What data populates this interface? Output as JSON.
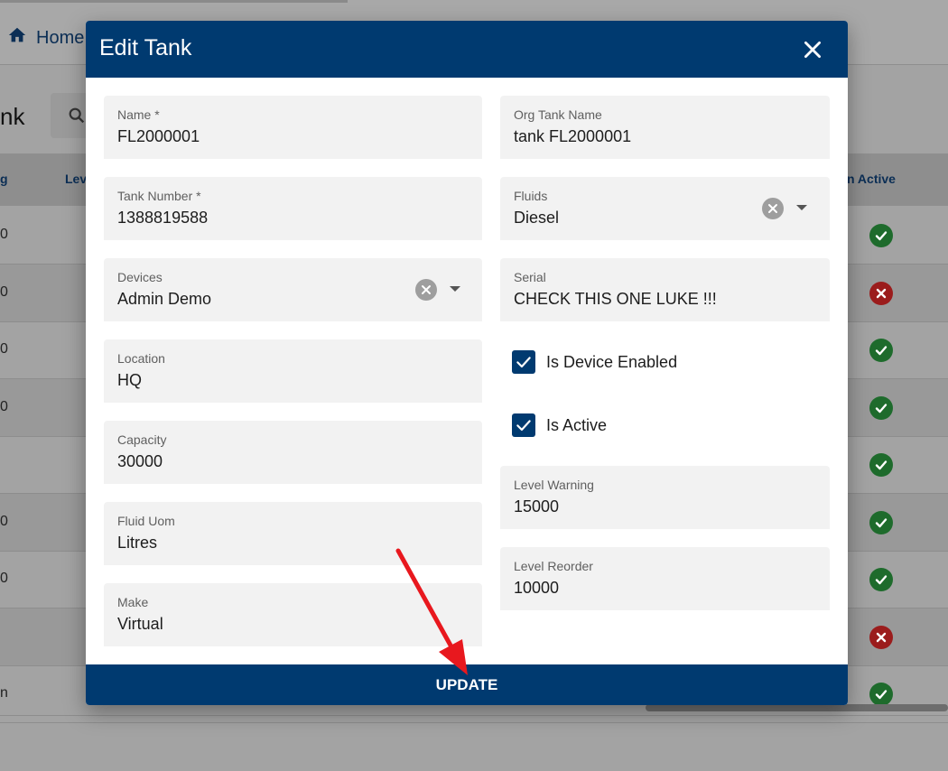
{
  "background": {
    "home_label": "Home",
    "page_title_fragment": "nk",
    "columns": {
      "col1": "g",
      "col2": "Lev",
      "active": "n Active"
    },
    "rows": [
      {
        "cell": "0",
        "status": "ok"
      },
      {
        "cell": "0",
        "status": "bad"
      },
      {
        "cell": "0",
        "status": "ok"
      },
      {
        "cell": "0",
        "status": "ok"
      },
      {
        "cell": "",
        "status": "ok"
      },
      {
        "cell": "0",
        "status": "ok"
      },
      {
        "cell": "0",
        "status": "ok"
      },
      {
        "cell": "",
        "status": "bad"
      },
      {
        "cell": "n",
        "status": "ok"
      }
    ]
  },
  "dialog": {
    "title": "Edit Tank",
    "left_fields": [
      {
        "label": "Name *",
        "value": "FL2000001"
      },
      {
        "label": "Tank Number *",
        "value": "1388819588"
      },
      {
        "label": "Devices",
        "value": "Admin Demo"
      },
      {
        "label": "Location",
        "value": "HQ"
      },
      {
        "label": "Capacity",
        "value": "30000"
      },
      {
        "label": "Fluid Uom",
        "value": "Litres"
      },
      {
        "label": "Make",
        "value": "Virtual"
      }
    ],
    "right_fields": [
      {
        "label": "Org Tank Name",
        "value": "tank FL2000001"
      },
      {
        "label": "Fluids",
        "value": "Diesel"
      },
      {
        "label": "Serial",
        "value": "CHECK THIS ONE LUKE !!!"
      },
      {
        "label": "Level Warning",
        "value": "15000"
      },
      {
        "label": "Level Reorder",
        "value": "10000"
      }
    ],
    "checkboxes": [
      {
        "label": "Is Device Enabled",
        "checked": true
      },
      {
        "label": "Is Active",
        "checked": true
      }
    ],
    "update_label": "UPDATE"
  },
  "colors": {
    "primary": "#003a70",
    "success": "#1e6b2c",
    "danger": "#9b1c1c",
    "annotation_arrow": "#e8181e"
  }
}
